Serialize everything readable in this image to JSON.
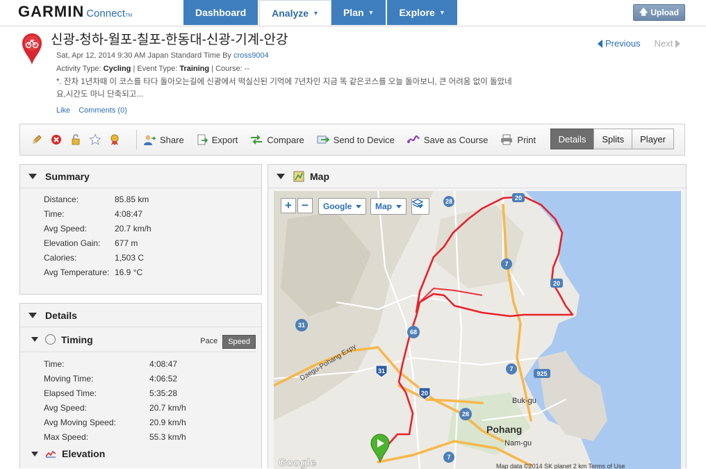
{
  "brand": {
    "name": "GARMIN",
    "sub": "Connect",
    "tm": "TM"
  },
  "nav": {
    "tabs": [
      {
        "label": "Dashboard"
      },
      {
        "label": "Analyze"
      },
      {
        "label": "Plan"
      },
      {
        "label": "Explore"
      }
    ],
    "upload": "Upload"
  },
  "activity": {
    "title": "신광-청하-월포-칠포-한동대-신광-기계-안강",
    "date": "Sat, Apr 12, 2014 9:30 AM Japan Standard Time By",
    "user": "cross9004",
    "type_label": "Activity Type:",
    "type_value": "Cycling",
    "event_label": "| Event Type:",
    "event_value": "Training",
    "course_label": "| Course: --",
    "description": "*. 잔차 1년차때 이 코스를 타다 돌아오는길에 신광에서 떡실신된 기억에 7년차인 지금 똑 같은코스를 오늘 돌아보니, 큰 어려움 없이 돌았네요,시간도 마니 단축되고...",
    "like": "Like",
    "comments": "Comments (0)",
    "previous": "Previous",
    "next": "Next"
  },
  "toolbar": {
    "actions": [
      {
        "label": "Share"
      },
      {
        "label": "Export"
      },
      {
        "label": "Compare"
      },
      {
        "label": "Send to Device"
      },
      {
        "label": "Save as Course"
      },
      {
        "label": "Print"
      }
    ],
    "views": [
      "Details",
      "Splits",
      "Player"
    ]
  },
  "summary": {
    "title": "Summary",
    "rows": [
      {
        "k": "Distance:",
        "v": "85.85 km"
      },
      {
        "k": "Time:",
        "v": "4:08:47"
      },
      {
        "k": "Avg Speed:",
        "v": "20.7 km/h"
      },
      {
        "k": "Elevation Gain:",
        "v": "677 m"
      },
      {
        "k": "Calories:",
        "v": "1,503 C"
      },
      {
        "k": "Avg Temperature:",
        "v": "16.9 °C"
      }
    ]
  },
  "details": {
    "title": "Details",
    "timing_title": "Timing",
    "pace": "Pace",
    "speed": "Speed",
    "rows": [
      {
        "k": "Time:",
        "v": "4:08:47"
      },
      {
        "k": "Moving Time:",
        "v": "4:06:52"
      },
      {
        "k": "Elapsed Time:",
        "v": "5:35:28"
      },
      {
        "k": "Avg Speed:",
        "v": "20.7 km/h"
      },
      {
        "k": "Avg Moving Speed:",
        "v": "20.9 km/h"
      },
      {
        "k": "Max Speed:",
        "v": "55.3 km/h"
      }
    ],
    "elevation_title": "Elevation"
  },
  "map": {
    "title": "Map",
    "provider": "Google",
    "maptype": "Map",
    "labels": {
      "buk": "Buk-gu",
      "pohang": "Pohang",
      "nam": "Nam-gu",
      "expy": "Daegu-Pohang Expy",
      "google": "Google",
      "credit": "Map data ©2014 SK planet    2 km        Terms of Use"
    },
    "route_numbers": [
      "28",
      "20",
      "7",
      "20",
      "31",
      "68",
      "31",
      "7",
      "20",
      "925",
      "28",
      "7"
    ],
    "colors": {
      "water": "#a9c9f0",
      "land": "#eceae5",
      "route": "#e8212a",
      "road": "#f7b74c",
      "start": "#4cb32e"
    }
  }
}
